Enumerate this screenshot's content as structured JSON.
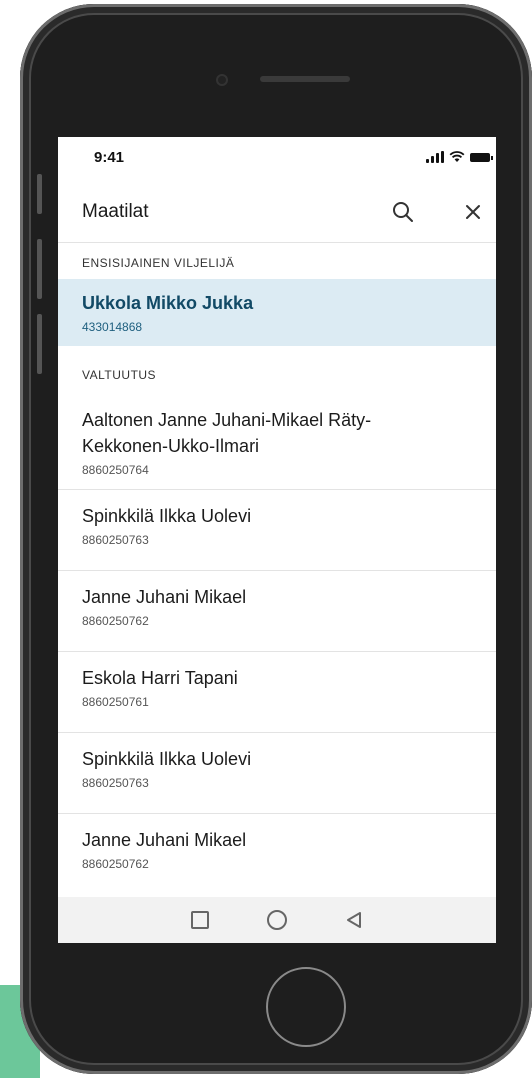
{
  "status": {
    "time": "9:41"
  },
  "appbar": {
    "title": "Maatilat"
  },
  "icons": {
    "search": "search-icon",
    "close": "close-icon"
  },
  "colors": {
    "selected_bg": "#dcebf3",
    "selected_text": "#124a66",
    "accent_green": "#6cc79a"
  },
  "sections": {
    "primary_header": "ENSISIJAINEN VILJELIJÄ",
    "authorization_header": "VALTUUTUS"
  },
  "primary": {
    "name": "Ukkola Mikko Jukka",
    "id": "433014868"
  },
  "items": [
    {
      "name": "Aaltonen Janne Juhani-Mikael Räty-Kekkonen-Ukko-Ilmari",
      "id": "8860250764"
    },
    {
      "name": "Spinkkilä Ilkka Uolevi",
      "id": "8860250763"
    },
    {
      "name": "Janne Juhani Mikael",
      "id": "8860250762"
    },
    {
      "name": "Eskola Harri Tapani",
      "id": "8860250761"
    },
    {
      "name": "Spinkkilä Ilkka Uolevi",
      "id": "8860250763"
    },
    {
      "name": "Janne Juhani Mikael",
      "id": "8860250762"
    }
  ]
}
